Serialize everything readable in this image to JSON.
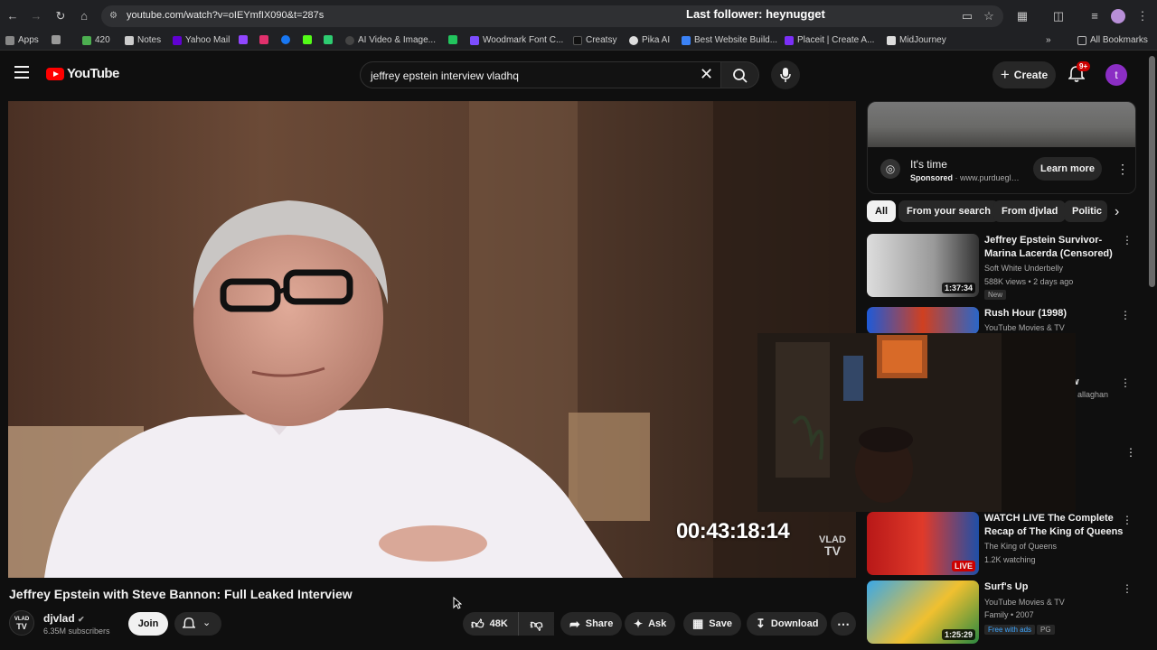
{
  "browser": {
    "url": "youtube.com/watch?v=oIEYmfIX090&t=287s",
    "stream_overlay": "Last follower: heynugget",
    "bookmarks": [
      {
        "label": "Apps",
        "color": "#888888"
      },
      {
        "label": "420",
        "color": "#4caf50"
      },
      {
        "label": "Notes",
        "color": "#cccccc"
      },
      {
        "label": "Yahoo Mail",
        "color": "#6001d2"
      },
      {
        "label": "",
        "color": "#9146ff"
      },
      {
        "label": "",
        "color": "#e1306c"
      },
      {
        "label": "",
        "color": "#1877f2"
      },
      {
        "label": "",
        "color": "#53fc18"
      },
      {
        "label": "",
        "color": "#2ecc71"
      },
      {
        "label": "AI Video & Image...",
        "color": "#444444"
      },
      {
        "label": "",
        "color": "#22c55e"
      },
      {
        "label": "Woodmark Font C...",
        "color": "#7c4dff"
      },
      {
        "label": "Creatsy",
        "color": "#111111"
      },
      {
        "label": "Pika AI",
        "color": "#dddddd"
      },
      {
        "label": "Best Website Build...",
        "color": "#3b82f6"
      },
      {
        "label": "Placeit | Create A...",
        "color": "#7b2ff7"
      },
      {
        "label": "MidJourney",
        "color": "#dddddd"
      }
    ],
    "all_bookmarks": "All Bookmarks"
  },
  "header": {
    "logo": "YouTube",
    "search_query": "jeffrey epstein interview vladhq",
    "create": "Create",
    "notifications_badge": "9+",
    "avatar_letter": "t"
  },
  "video": {
    "timecode": "00:43:18:14",
    "watermark_line1": "VLAD",
    "watermark_line2": "TV",
    "title": "Jeffrey Epstein with Steve Bannon: Full Leaked Interview",
    "channel_avatar_line1": "VLAD",
    "channel_avatar_line2": "TV",
    "channel": "djvlad",
    "subscribers": "6.35M subscribers",
    "join": "Join",
    "likes": "48K",
    "share": "Share",
    "ask": "Ask",
    "save": "Save",
    "download": "Download"
  },
  "ad": {
    "headline": "It's time",
    "sponsored": "Sponsored",
    "domain": "www.purduegl…",
    "cta": "Learn more"
  },
  "chips": [
    "All",
    "From your search",
    "From djvlad",
    "Politic"
  ],
  "recommendations": [
    {
      "title": "Jeffrey Epstein Survivor-Marina Lacerda (Censored)",
      "channel": "Soft White Underbelly",
      "meta": "588K views • 2 days ago",
      "badge": "New",
      "duration": "1:37:34"
    },
    {
      "title": "Rush Hour (1998)",
      "channel": "YouTube Movies & TV",
      "meta": "",
      "badge": "",
      "duration": ""
    },
    {
      "title": "w",
      "channel": "allaghan",
      "meta": "",
      "badge": "",
      "duration": ""
    },
    {
      "title": "WATCH LIVE The Complete Recap of The King of Queens",
      "channel": "The King of Queens",
      "meta": "1.2K watching",
      "badge": "",
      "duration": "LIVE"
    },
    {
      "title": "Surf's Up",
      "channel": "YouTube Movies & TV",
      "meta": "Family • 2007",
      "badge": "Free with ads",
      "badge2": "PG",
      "duration": "1:25:29"
    }
  ]
}
